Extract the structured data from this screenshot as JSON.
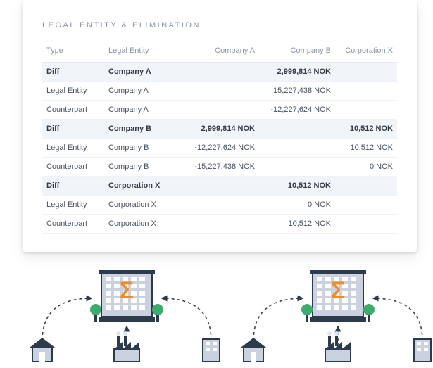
{
  "title": "LEGAL ENTITY & ELIMINATION",
  "columns": {
    "type": "Type",
    "legal_entity": "Legal Entity",
    "company_a": "Company A",
    "company_b": "Company B",
    "corporation_x": "Corporation X"
  },
  "rows": [
    {
      "kind": "diff",
      "type": "Diff",
      "entity": "Company A",
      "a": "",
      "b": "2,999,814 NOK",
      "x": ""
    },
    {
      "kind": "normal",
      "type": "Legal Entity",
      "entity": "Company A",
      "a": "",
      "b": "15,227,438 NOK",
      "x": ""
    },
    {
      "kind": "normal",
      "type": "Counterpart",
      "entity": "Company A",
      "a": "",
      "b": "-12,227,624 NOK",
      "x": ""
    },
    {
      "kind": "diff",
      "type": "Diff",
      "entity": "Company B",
      "a": "2,999,814 NOK",
      "b": "",
      "x": "10,512 NOK"
    },
    {
      "kind": "normal",
      "type": "Legal Entity",
      "entity": "Company B",
      "a": "-12,227,624 NOK",
      "b": "",
      "x": "10,512 NOK"
    },
    {
      "kind": "normal",
      "type": "Counterpart",
      "entity": "Company B",
      "a": "-15,227,438 NOK",
      "b": "",
      "x": "0 NOK"
    },
    {
      "kind": "diff",
      "type": "Diff",
      "entity": "Corporation X",
      "a": "",
      "b": "10,512 NOK",
      "x": ""
    },
    {
      "kind": "normal",
      "type": "Legal Entity",
      "entity": "Corporation X",
      "a": "",
      "b": "0 NOK",
      "x": ""
    },
    {
      "kind": "normal",
      "type": "Counterpart",
      "entity": "Corporation X",
      "a": "",
      "b": "10,512 NOK",
      "x": ""
    }
  ],
  "chart_data": {
    "type": "table",
    "title": "LEGAL ENTITY & ELIMINATION",
    "columns": [
      "Type",
      "Legal Entity",
      "Company A",
      "Company B",
      "Corporation X"
    ],
    "currency": "NOK",
    "data": [
      [
        "Diff",
        "Company A",
        null,
        2999814,
        null
      ],
      [
        "Legal Entity",
        "Company A",
        null,
        15227438,
        null
      ],
      [
        "Counterpart",
        "Company A",
        null,
        -12227624,
        null
      ],
      [
        "Diff",
        "Company B",
        2999814,
        null,
        10512
      ],
      [
        "Legal Entity",
        "Company B",
        -12227624,
        null,
        10512
      ],
      [
        "Counterpart",
        "Company B",
        -15227438,
        null,
        0
      ],
      [
        "Diff",
        "Corporation X",
        null,
        10512,
        null
      ],
      [
        "Legal Entity",
        "Corporation X",
        null,
        0,
        null
      ],
      [
        "Counterpart",
        "Corporation X",
        null,
        10512,
        null
      ]
    ]
  }
}
